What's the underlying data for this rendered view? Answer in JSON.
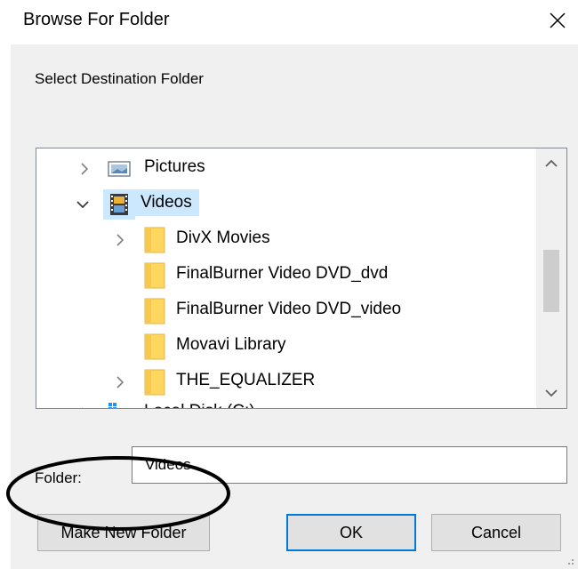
{
  "window": {
    "title": "Browse For Folder",
    "close_icon": "close-icon"
  },
  "prompt": "Select Destination Folder",
  "tree": {
    "items": [
      {
        "label": "Pictures",
        "expander": "collapsed",
        "icon": "pictures-folder-icon",
        "selected": false
      },
      {
        "label": "Videos",
        "expander": "expanded",
        "icon": "videos-folder-icon",
        "selected": true
      },
      {
        "label": "DivX Movies",
        "expander": "collapsed",
        "icon": "folder-icon",
        "selected": false
      },
      {
        "label": "FinalBurner Video DVD_dvd",
        "expander": "none",
        "icon": "folder-icon",
        "selected": false
      },
      {
        "label": "FinalBurner Video DVD_video",
        "expander": "none",
        "icon": "folder-icon",
        "selected": false
      },
      {
        "label": "Movavi Library",
        "expander": "none",
        "icon": "folder-icon",
        "selected": false
      },
      {
        "label": "THE_EQUALIZER",
        "expander": "collapsed",
        "icon": "folder-icon",
        "selected": false
      },
      {
        "label": "Local Disk (C:)",
        "expander": "collapsed",
        "icon": "drive-icon",
        "selected": false
      }
    ],
    "scroll_position": 0.45
  },
  "folder": {
    "label": "Folder:",
    "value": "Videos"
  },
  "buttons": {
    "make_new_folder": "Make New Folder",
    "ok": "OK",
    "cancel": "Cancel"
  },
  "colors": {
    "selection": "#cce8ff",
    "folder_yellow": "#ffd75e",
    "default_button_border": "#0078d7",
    "annotation": "#000000"
  }
}
